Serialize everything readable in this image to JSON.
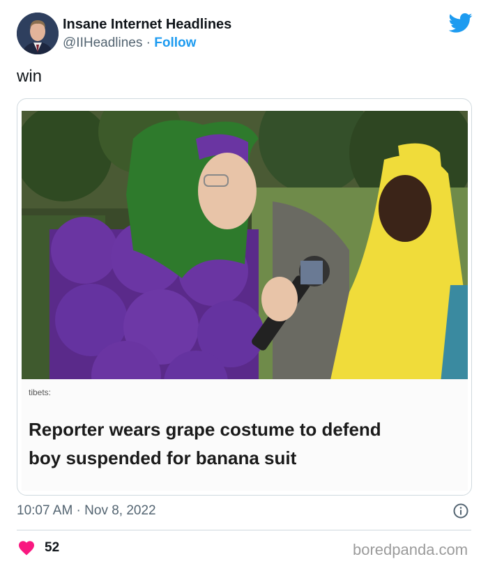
{
  "tweet": {
    "author_name": "Insane Internet Headlines",
    "author_handle": "@IIHeadlines",
    "separator": "·",
    "follow_label": "Follow",
    "text": "win",
    "timestamp": "10:07 AM · Nov 8, 2022",
    "likes": "52"
  },
  "card": {
    "credit": "tibets:",
    "headline_line1": "Reporter wears grape costume to defend",
    "headline_line2": "boy suspended for banana suit"
  },
  "watermark": "boredpanda.com",
  "colors": {
    "accent": "#1d9bf0",
    "heart": "#f91880",
    "muted": "#536471"
  },
  "icons": [
    "twitter-bird-icon",
    "info-icon",
    "heart-icon"
  ]
}
